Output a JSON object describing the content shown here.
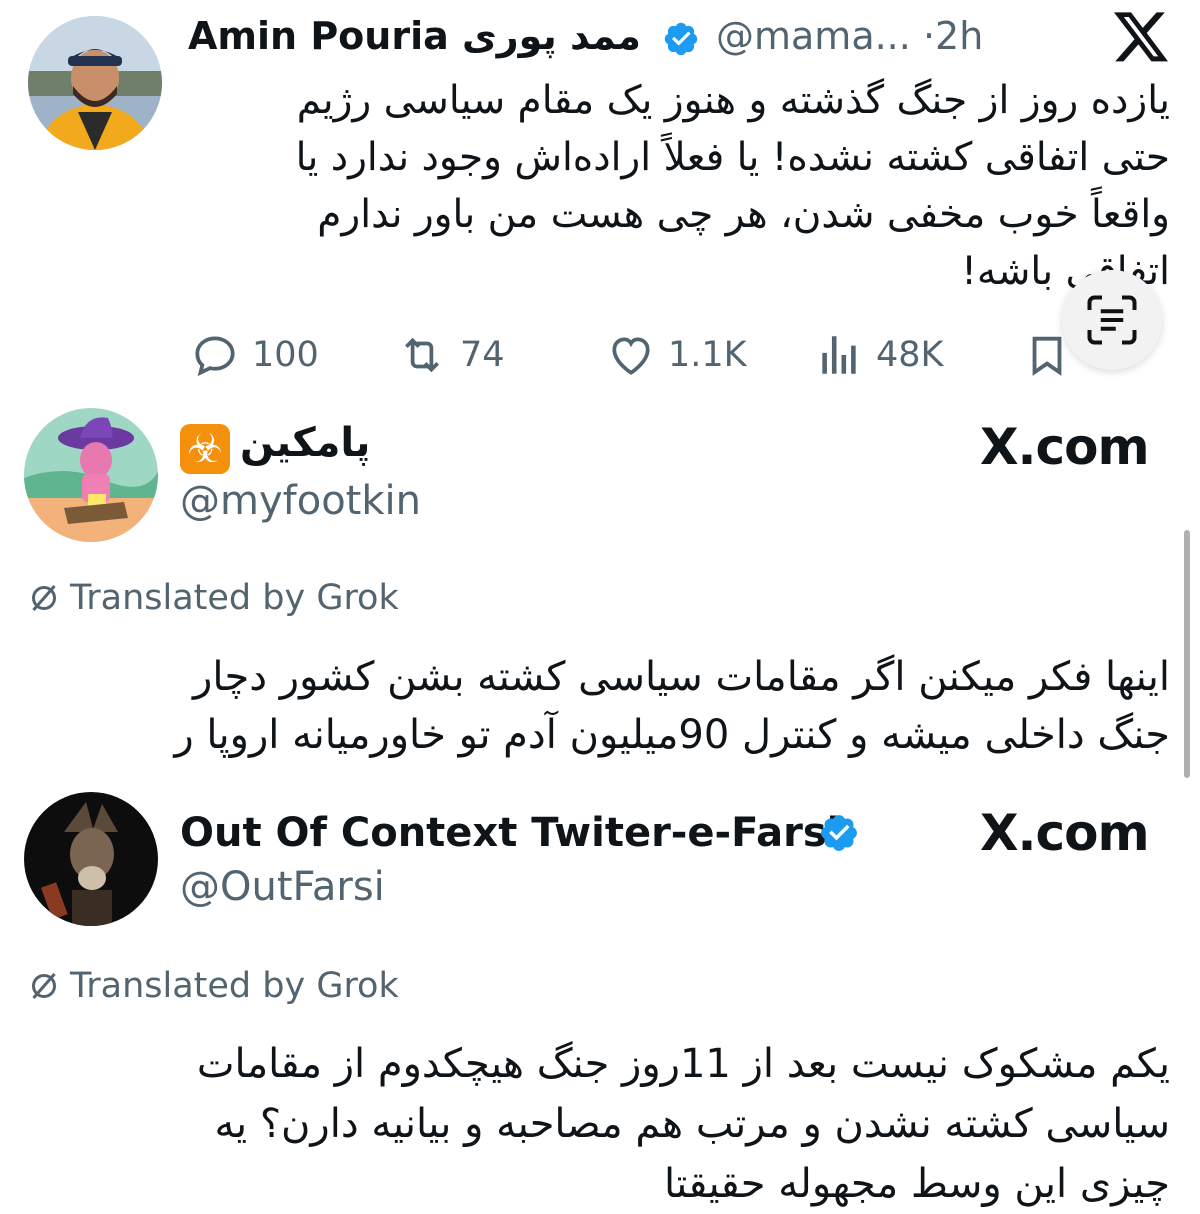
{
  "tweet1": {
    "name_latin": "Amin Pouria",
    "name_farsi": "ممد پوری",
    "handle": "@mama...",
    "separator": "·",
    "time": "2h",
    "lines": [
      "یازده روز از جنگ گذشته و هنوز یک مقام سیاسی رژیم",
      "حتی اتفاقی کشته نشده! یا فعلاً اراده‌اش وجود ندارد یا",
      "واقعاً خوب مخفی شدن، هر چی هست من باور ندارم",
      "اتفاقی باشه!"
    ],
    "actions": {
      "replies": "100",
      "reposts": "74",
      "likes": "1.1K",
      "views": "48K"
    }
  },
  "tweet2": {
    "name": "پامکین",
    "emoji": "☣",
    "handle": "@myfootkin",
    "site": "X.com",
    "translated": "Translated by Grok",
    "lines": [
      "اینها فکر میکنن اگر مقامات سیاسی کشته بشن کشور دچار",
      "جنگ داخلی میشه و کنترل 90میلیون آدم تو خاورمیانه اروپا ر"
    ]
  },
  "tweet3": {
    "name": "Out Of Context Twiter-e-Farsi",
    "handle": "@OutFarsi",
    "site": "X.com",
    "translated": "Translated by Grok",
    "lines": [
      "یکم مشکوک نیست بعد از 11روز جنگ هیچکدوم از مقامات",
      "سیاسی کشته نشدن و مرتب هم مصاحبه و بیانیه دارن؟ یه",
      "چیزی این وسط مجهوله حقیقتا"
    ]
  },
  "colors": {
    "verified": "#1d9bf0",
    "muted": "#536471",
    "text": "#0f1419",
    "hazard": "#f4900c"
  }
}
